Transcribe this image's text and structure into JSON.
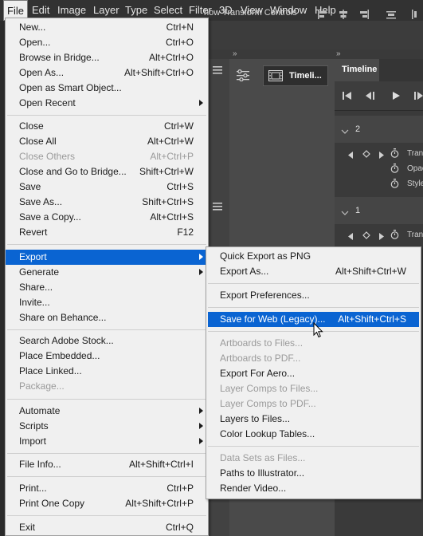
{
  "menubar": {
    "items": [
      "File",
      "Edit",
      "Image",
      "Layer",
      "Type",
      "Select",
      "Filter",
      "3D",
      "View",
      "Window",
      "Help"
    ],
    "active": "File"
  },
  "options": {
    "transform_label": "how Transform Controls"
  },
  "panels": {
    "collapse_chevrons": "»",
    "layer_label": "Timeli...",
    "timeline_tab": "Timeline",
    "groups": [
      {
        "label": "2",
        "tracks": [
          "Tran",
          "Opac",
          "Style"
        ]
      },
      {
        "label": "1",
        "tracks": [
          "Tran"
        ]
      }
    ]
  },
  "file_menu": {
    "items": [
      {
        "label": "New...",
        "shortcut": "Ctrl+N"
      },
      {
        "label": "Open...",
        "shortcut": "Ctrl+O"
      },
      {
        "label": "Browse in Bridge...",
        "shortcut": "Alt+Ctrl+O"
      },
      {
        "label": "Open As...",
        "shortcut": "Alt+Shift+Ctrl+O"
      },
      {
        "label": "Open as Smart Object...",
        "shortcut": ""
      },
      {
        "label": "Open Recent",
        "shortcut": "",
        "submenu": true
      },
      {
        "label": "Close",
        "shortcut": "Ctrl+W"
      },
      {
        "label": "Close All",
        "shortcut": "Alt+Ctrl+W"
      },
      {
        "label": "Close Others",
        "shortcut": "Alt+Ctrl+P",
        "disabled": true
      },
      {
        "label": "Close and Go to Bridge...",
        "shortcut": "Shift+Ctrl+W"
      },
      {
        "label": "Save",
        "shortcut": "Ctrl+S"
      },
      {
        "label": "Save As...",
        "shortcut": "Shift+Ctrl+S"
      },
      {
        "label": "Save a Copy...",
        "shortcut": "Alt+Ctrl+S"
      },
      {
        "label": "Revert",
        "shortcut": "F12"
      },
      {
        "label": "Export",
        "shortcut": "",
        "submenu": true,
        "highlighted": true
      },
      {
        "label": "Generate",
        "shortcut": "",
        "submenu": true
      },
      {
        "label": "Share...",
        "shortcut": ""
      },
      {
        "label": "Invite...",
        "shortcut": ""
      },
      {
        "label": "Share on Behance...",
        "shortcut": ""
      },
      {
        "label": "Search Adobe Stock...",
        "shortcut": ""
      },
      {
        "label": "Place Embedded...",
        "shortcut": ""
      },
      {
        "label": "Place Linked...",
        "shortcut": ""
      },
      {
        "label": "Package...",
        "shortcut": "",
        "disabled": true
      },
      {
        "label": "Automate",
        "shortcut": "",
        "submenu": true
      },
      {
        "label": "Scripts",
        "shortcut": "",
        "submenu": true
      },
      {
        "label": "Import",
        "shortcut": "",
        "submenu": true
      },
      {
        "label": "File Info...",
        "shortcut": "Alt+Shift+Ctrl+I"
      },
      {
        "label": "Print...",
        "shortcut": "Ctrl+P"
      },
      {
        "label": "Print One Copy",
        "shortcut": "Alt+Shift+Ctrl+P"
      },
      {
        "label": "Exit",
        "shortcut": "Ctrl+Q"
      }
    ]
  },
  "export_menu": {
    "items": [
      {
        "label": "Quick Export as PNG",
        "shortcut": ""
      },
      {
        "label": "Export As...",
        "shortcut": "Alt+Shift+Ctrl+W"
      },
      {
        "label": "Export Preferences...",
        "shortcut": ""
      },
      {
        "label": "Save for Web (Legacy)...",
        "shortcut": "Alt+Shift+Ctrl+S",
        "highlighted": true
      },
      {
        "label": "Artboards to Files...",
        "shortcut": "",
        "disabled": true
      },
      {
        "label": "Artboards to PDF...",
        "shortcut": "",
        "disabled": true
      },
      {
        "label": "Export For Aero...",
        "shortcut": ""
      },
      {
        "label": "Layer Comps to Files...",
        "shortcut": "",
        "disabled": true
      },
      {
        "label": "Layer Comps to PDF...",
        "shortcut": "",
        "disabled": true
      },
      {
        "label": "Layers to Files...",
        "shortcut": ""
      },
      {
        "label": "Color Lookup Tables...",
        "shortcut": ""
      },
      {
        "label": "Data Sets as Files...",
        "shortcut": "",
        "disabled": true
      },
      {
        "label": "Paths to Illustrator...",
        "shortcut": ""
      },
      {
        "label": "Render Video...",
        "shortcut": ""
      }
    ]
  }
}
